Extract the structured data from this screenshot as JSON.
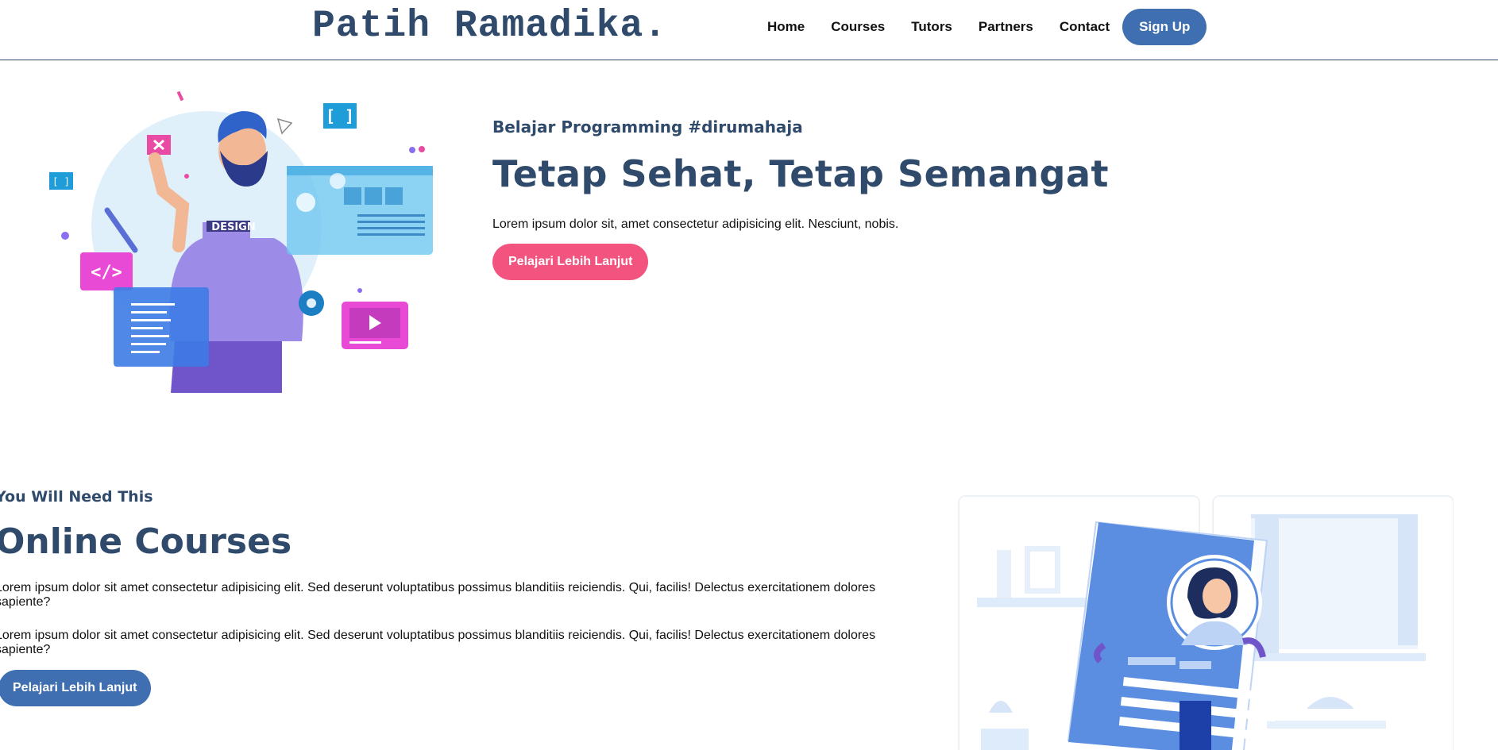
{
  "header": {
    "logo": "Patih Ramadika.",
    "nav": [
      "Home",
      "Courses",
      "Tutors",
      "Partners",
      "Contact"
    ],
    "signup": "Sign Up"
  },
  "hero": {
    "eyebrow": "Belajar Programming #dirumahaja",
    "title": "Tetap Sehat, Tetap Semangat",
    "description": "Lorem ipsum dolor sit, amet consectetur adipisicing elit. Nesciunt, nobis.",
    "button": "Pelajari Lebih Lanjut",
    "illustration_text": "DESIGN"
  },
  "courses": {
    "eyebrow": "You Will Need This",
    "title": "Online Courses",
    "paragraphs": [
      "Lorem ipsum dolor sit amet consectetur adipisicing elit. Sed deserunt voluptatibus possimus blanditiis reiciendis. Qui, facilis! Delectus exercitationem dolores sapiente?",
      "Lorem ipsum dolor sit amet consectetur adipisicing elit. Sed deserunt voluptatibus possimus blanditiis reiciendis. Qui, facilis! Delectus exercitationem dolores sapiente?"
    ],
    "button": "Pelajari Lebih Lanjut"
  },
  "colors": {
    "brand": "#2f4a6b",
    "primary_button": "#3f6fb0",
    "accent_button": "#f2547f"
  }
}
